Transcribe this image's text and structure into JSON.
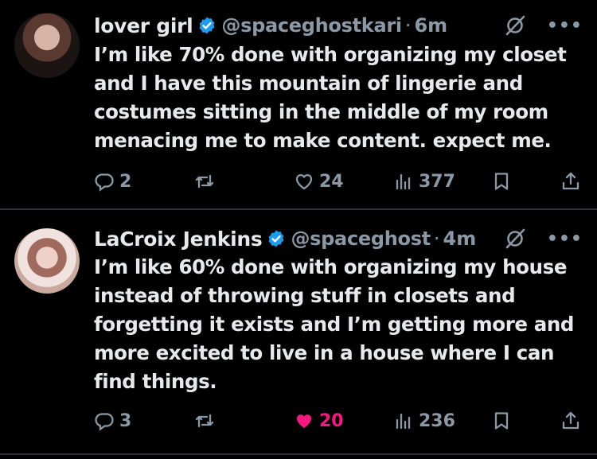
{
  "tweets": [
    {
      "display_name": "lover girl",
      "handle": "@spaceghostkari",
      "separator": "·",
      "time": "6m",
      "text": "I’m like 70% done with organizing my closet and I have this mountain of lingerie and costumes sitting in the middle of my room menacing me to make content. expect me.",
      "replies": "2",
      "likes": "24",
      "views": "377",
      "liked": false
    },
    {
      "display_name": "LaCroix Jenkins",
      "handle": "@spaceghost",
      "separator": "·",
      "time": "4m",
      "text": "I’m like 60% done with organizing my house instead of throwing stuff in closets and forgetting it exists and I’m getting more and more excited to live in a house where I can find things.",
      "replies": "3",
      "likes": "20",
      "views": "236",
      "liked": true
    }
  ],
  "colors": {
    "background": "#000000",
    "text": "#e7e9ea",
    "muted": "#8b98a5",
    "verified": "#1d9bf0",
    "like_active": "#f91880",
    "divider": "#2f3336"
  },
  "icons": [
    "verified-badge-icon",
    "grok-icon",
    "more-icon",
    "reply-icon",
    "retweet-icon",
    "like-icon",
    "views-icon",
    "bookmark-icon",
    "share-icon"
  ]
}
